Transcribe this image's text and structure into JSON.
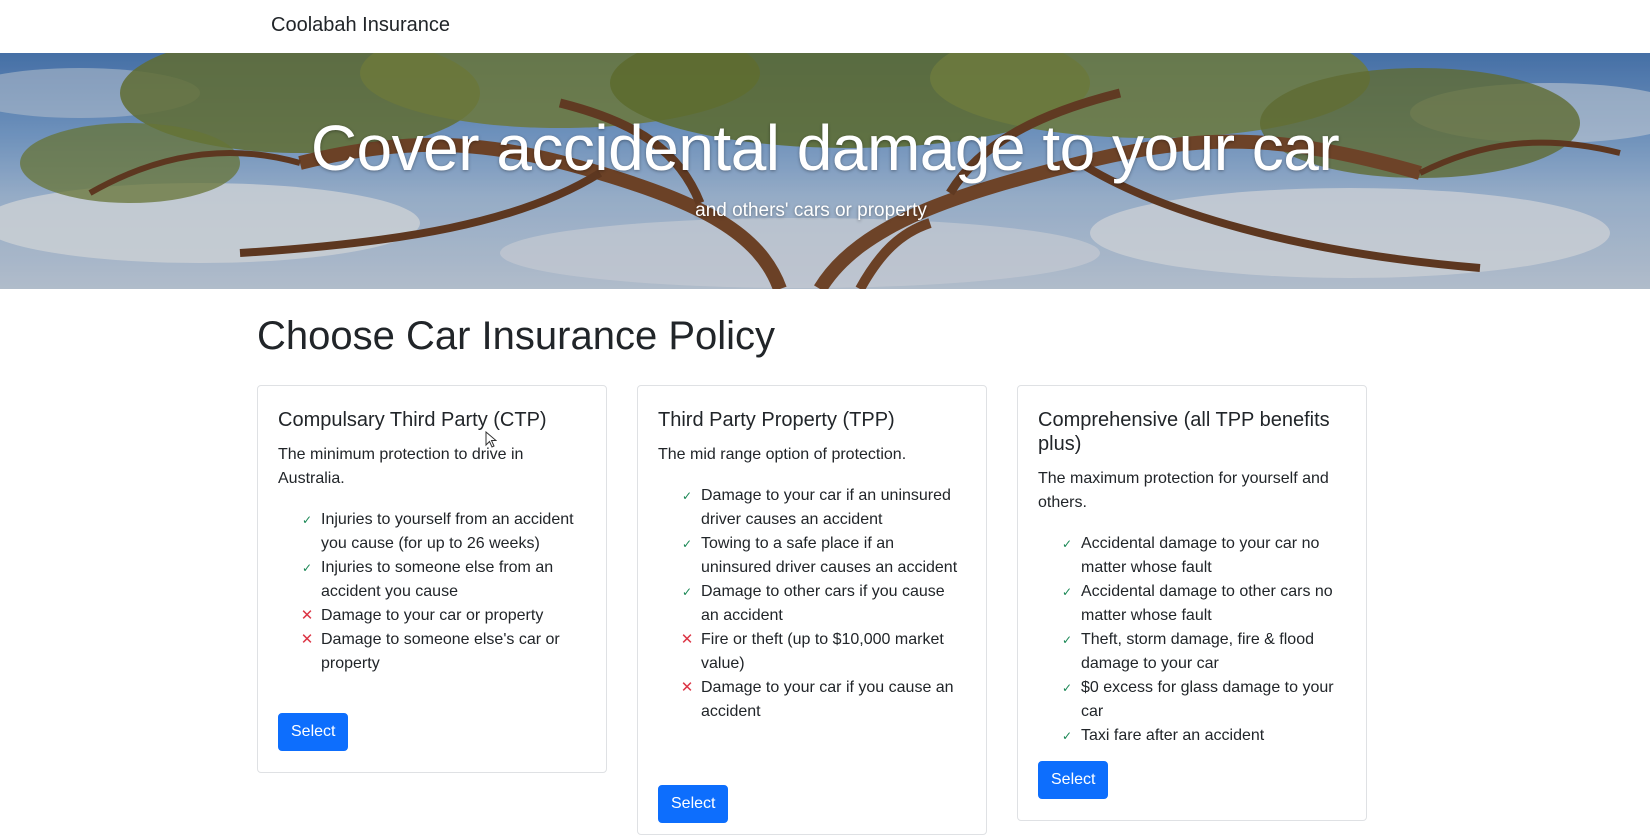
{
  "navbar": {
    "brand": "Coolabah Insurance"
  },
  "hero": {
    "title": "Cover accidental damage to your car",
    "subtitle": "and others' cars or property"
  },
  "page": {
    "heading": "Choose Car Insurance Policy"
  },
  "colors": {
    "primary": "#0d6efd",
    "check": "#198754",
    "cross": "#dc3545"
  },
  "icons": {
    "included": "check-icon",
    "excluded": "cross-icon"
  },
  "policies": [
    {
      "title": "Compulsary Third Party (CTP)",
      "description": "The minimum protection to drive in Australia.",
      "features": [
        {
          "included": true,
          "text": "Injuries to yourself from an accident you cause (for up to 26 weeks)"
        },
        {
          "included": true,
          "text": "Injuries to someone else from an accident you cause"
        },
        {
          "included": false,
          "text": "Damage to your car or property"
        },
        {
          "included": false,
          "text": "Damage to someone else's car or property"
        }
      ],
      "button_label": "Select"
    },
    {
      "title": "Third Party Property (TPP)",
      "description": "The mid range option of protection.",
      "features": [
        {
          "included": true,
          "text": "Damage to your car if an uninsured driver causes an accident"
        },
        {
          "included": true,
          "text": "Towing to a safe place if an uninsured driver causes an accident"
        },
        {
          "included": true,
          "text": "Damage to other cars if you cause an accident"
        },
        {
          "included": false,
          "text": "Fire or theft (up to $10,000 market value)"
        },
        {
          "included": false,
          "text": "Damage to your car if you cause an accident"
        }
      ],
      "button_label": "Select"
    },
    {
      "title": "Comprehensive (all TPP benefits plus)",
      "description": "The maximum protection for yourself and others.",
      "features": [
        {
          "included": true,
          "text": "Accidental damage to your car no matter whose fault"
        },
        {
          "included": true,
          "text": "Accidental damage to other cars no matter whose fault"
        },
        {
          "included": true,
          "text": "Theft, storm damage, fire & flood damage to your car"
        },
        {
          "included": true,
          "text": "$0 excess for glass damage to your car"
        },
        {
          "included": true,
          "text": "Taxi fare after an accident"
        }
      ],
      "button_label": "Select"
    }
  ]
}
